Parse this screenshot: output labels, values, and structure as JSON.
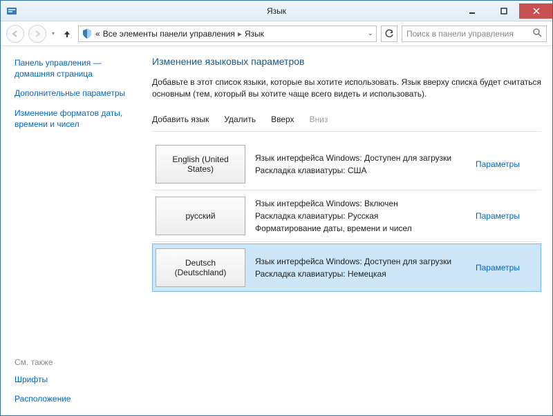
{
  "window": {
    "title": "Язык"
  },
  "nav": {
    "breadcrumb_prefix": "«",
    "crumb1": "Все элементы панели управления",
    "crumb2": "Язык",
    "search_placeholder": "Поиск в панели управления"
  },
  "sidebar": {
    "links": [
      "Панель управления — домашняя страница",
      "Дополнительные параметры",
      "Изменение форматов даты, времени и чисел"
    ],
    "also_label": "См. также",
    "also_links": [
      "Шрифты",
      "Расположение"
    ]
  },
  "main": {
    "heading": "Изменение языковых параметров",
    "description": "Добавьте в этот список языки, которые вы хотите использовать. Язык вверху списка будет считаться основным (тем, который вы хотите чаще всего видеть и использовать).",
    "toolbar": {
      "add": "Добавить язык",
      "remove": "Удалить",
      "up": "Вверх",
      "down": "Вниз"
    },
    "params_label": "Параметры",
    "languages": [
      {
        "name": "English (United States)",
        "lines": [
          "Язык интерфейса Windows: Доступен для загрузки",
          "Раскладка клавиатуры: США"
        ],
        "selected": false
      },
      {
        "name": "русский",
        "lines": [
          "Язык интерфейса Windows: Включен",
          "Раскладка клавиатуры: Русская",
          "Форматирование даты, времени и чисел"
        ],
        "selected": false
      },
      {
        "name": "Deutsch (Deutschland)",
        "lines": [
          "Язык интерфейса Windows: Доступен для загрузки",
          "Раскладка клавиатуры: Немецкая"
        ],
        "selected": true
      }
    ]
  }
}
